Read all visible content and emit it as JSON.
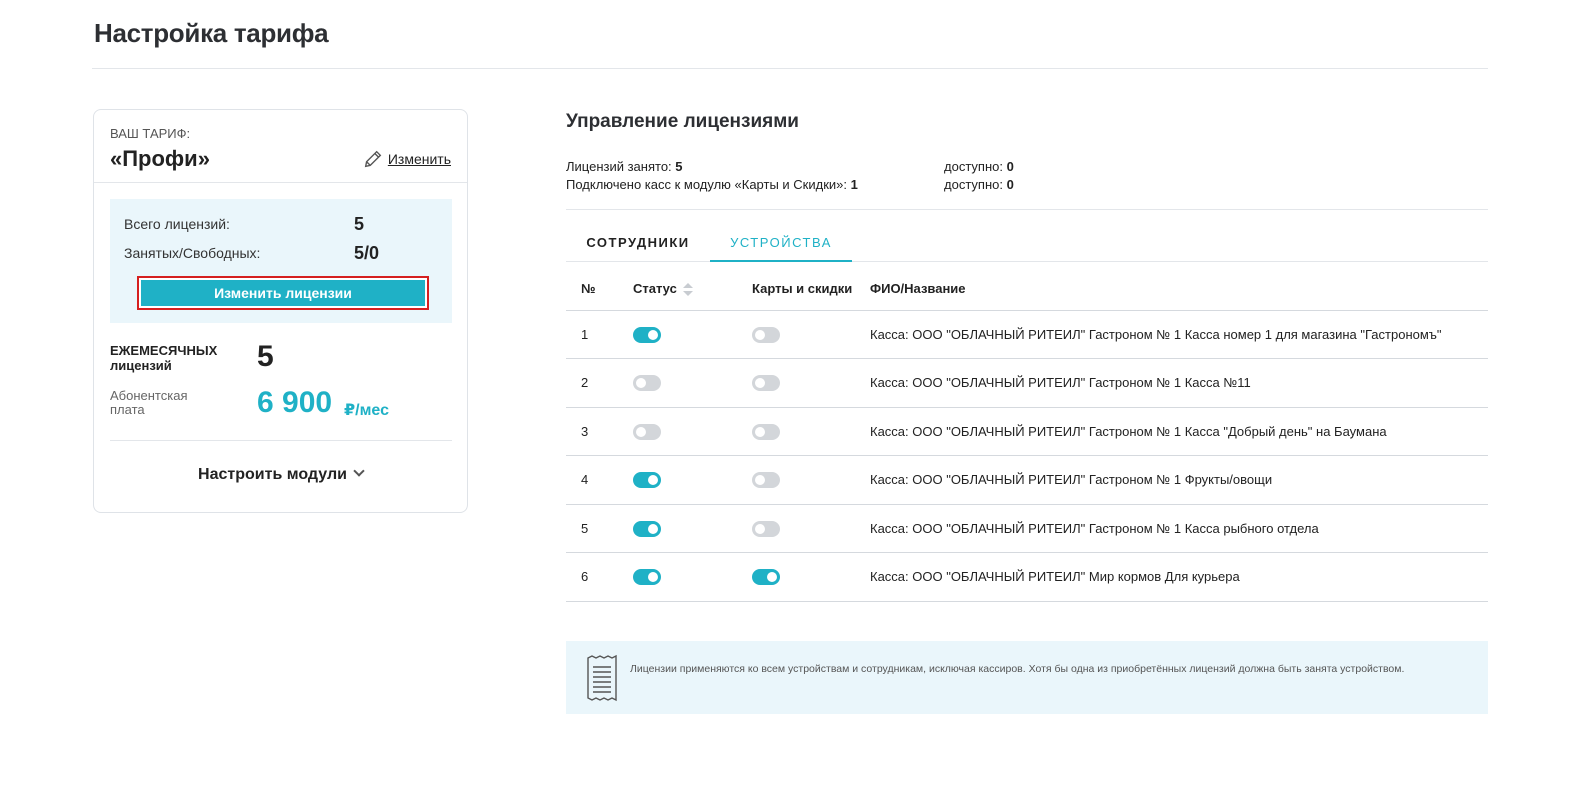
{
  "page": {
    "title": "Настройка тарифа"
  },
  "tariff": {
    "caption": "ВАШ ТАРИФ:",
    "name": "«Профи»",
    "change_label": "Изменить",
    "total_licenses_label": "Всего лицензий:",
    "total_licenses_value": "5",
    "busy_free_label": "Занятых/Свободных:",
    "busy_free_value": "5/0",
    "change_licenses_button": "Изменить лицензии",
    "monthly_label_1": "ЕЖЕМЕСЯЧНЫХ",
    "monthly_label_2": "лицензий",
    "monthly_value": "5",
    "fee_label": "Абонентская плата",
    "fee_value": "6 900",
    "fee_unit": "₽/мес",
    "modules_label": "Настроить модули"
  },
  "licenses": {
    "title": "Управление лицензиями",
    "occupied_label": "Лицензий занято:",
    "occupied_value": "5",
    "occupied_available_label": "доступно:",
    "occupied_available_value": "0",
    "connected_label": "Подключено касс к модулю «Карты и Скидки»:",
    "connected_value": "1",
    "connected_available_label": "доступно:",
    "connected_available_value": "0"
  },
  "tabs": {
    "employees": "СОТРУДНИКИ",
    "devices": "УСТРОЙСТВА",
    "active": "devices"
  },
  "table": {
    "headers": {
      "num": "№",
      "status": "Статус",
      "cards": "Карты и скидки",
      "name": "ФИО/Название"
    },
    "rows": [
      {
        "num": "1",
        "status": true,
        "cards": false,
        "name": "Касса: ООО \"ОБЛАЧНЫЙ РИТЕИЛ\" Гастроном № 1 Касса номер 1 для магазина \"Гастрономъ\""
      },
      {
        "num": "2",
        "status": false,
        "cards": false,
        "name": "Касса: ООО \"ОБЛАЧНЫЙ РИТЕИЛ\" Гастроном № 1 Касса №11"
      },
      {
        "num": "3",
        "status": false,
        "cards": false,
        "name": "Касса: ООО \"ОБЛАЧНЫЙ РИТЕИЛ\" Гастроном № 1 Касса \"Добрый день\" на Баумана"
      },
      {
        "num": "4",
        "status": true,
        "cards": false,
        "name": "Касса: ООО \"ОБЛАЧНЫЙ РИТЕИЛ\" Гастроном № 1 Фрукты/овощи"
      },
      {
        "num": "5",
        "status": true,
        "cards": false,
        "name": "Касса: ООО \"ОБЛАЧНЫЙ РИТЕИЛ\" Гастроном № 1 Касса рыбного отдела"
      },
      {
        "num": "6",
        "status": true,
        "cards": true,
        "name": "Касса: ООО \"ОБЛАЧНЫЙ РИТЕИЛ\" Мир кормов Для курьера"
      }
    ]
  },
  "info": {
    "text": "Лицензии применяются ко всем устройствам и сотрудникам, исключая кассиров. Хотя бы одна из приобретённых лицензий должна быть занята устройством."
  },
  "colors": {
    "accent": "#1fb1c6",
    "highlight_border": "#d51f1f",
    "panel_bg": "#eaf6fb"
  }
}
